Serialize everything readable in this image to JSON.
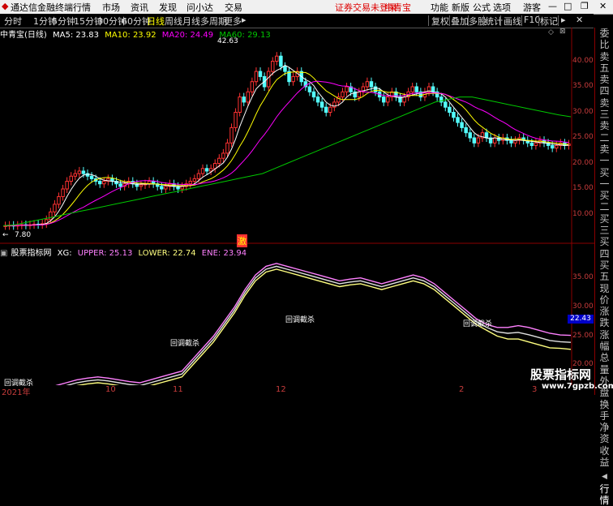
{
  "menubar": {
    "app_title": "通达信金融终端",
    "menus": [
      "行情",
      "市场",
      "资讯",
      "发现",
      "问小达",
      "交易"
    ],
    "alert": "证券交易未登录",
    "stock_name": "中青宝",
    "right": [
      "功能",
      "新版",
      "公式",
      "选项",
      "游客"
    ]
  },
  "toolbar": {
    "periods": [
      "分时",
      "1分钟",
      "5分钟",
      "15分钟",
      "30分钟",
      "60分钟",
      "日线",
      "周线",
      "月线",
      "多周期",
      "更多"
    ],
    "selected_period": "日线",
    "right_buttons": [
      "复权",
      "叠加",
      "多股",
      "统计",
      "画线",
      "F10",
      "标记"
    ]
  },
  "chart_header": {
    "title": "中青宝(日线)",
    "ma5": "MA5: 23.83",
    "ma10": "MA10: 23.92",
    "ma20": "MA20: 24.49",
    "ma60": "MA60: 29.13",
    "high_label": "42.63",
    "low_label": "7.80",
    "marker": "激"
  },
  "indicator_header": {
    "title": "股票指标网",
    "xg": "XG:",
    "upper": "UPPER: 25.13",
    "lower": "LOWER: 22.74",
    "ene": "ENE: 23.94"
  },
  "annotations": [
    "回调截杀",
    "回调截杀",
    "回调截杀",
    "回调截杀"
  ],
  "right_panel": [
    "委比",
    "卖五",
    "卖四",
    "卖三",
    "卖二",
    "卖一",
    "买一",
    "买二",
    "买三",
    "买四",
    "买五",
    "现价",
    "涨跌",
    "涨幅",
    "总量",
    "外盘",
    "换手",
    "净资",
    "收益",
    "行情"
  ],
  "right_panel_selected": "行情",
  "ind_current_value": "22.43",
  "x_axis": [
    "2021年",
    "10",
    "11",
    "12",
    "2",
    "3"
  ],
  "watermark": "股票指标网",
  "watermark_url": "www.7gpzb.com",
  "colors": {
    "up": "#ff3232",
    "down": "#54ffff",
    "ma5": "#ffffff",
    "ma10": "#ffff00",
    "ma20": "#ff00ff",
    "ma60": "#00c800",
    "upper": "#ff80ff",
    "lower": "#ffff80",
    "ene": "#e0e0e0"
  },
  "chart_data": [
    {
      "type": "candlestick",
      "title": "中青宝(日线)",
      "ylim": [
        5,
        45
      ],
      "yticks": [
        10.0,
        15.0,
        20.0,
        25.0,
        30.0,
        35.0,
        40.0
      ],
      "high_value": 42.63,
      "low_value": 7.8,
      "closes": [
        7.8,
        7.9,
        7.8,
        7.9,
        8.0,
        7.9,
        8.0,
        8.1,
        8.0,
        8.2,
        9.0,
        10.5,
        12.0,
        13.5,
        15.0,
        16.5,
        17.5,
        18.0,
        18.5,
        18.0,
        17.5,
        17.0,
        16.5,
        16.0,
        16.5,
        17.0,
        16.5,
        16.0,
        15.5,
        16.0,
        16.5,
        16.0,
        15.5,
        15.8,
        16.0,
        16.5,
        16.0,
        15.5,
        15.0,
        15.5,
        16.0,
        15.5,
        15.0,
        15.5,
        16.0,
        16.5,
        17.0,
        18.0,
        19.0,
        18.5,
        19.0,
        20.0,
        21.0,
        22.0,
        24.0,
        27.0,
        30.0,
        33.0,
        32.0,
        34.0,
        36.0,
        38.0,
        37.0,
        35.0,
        38.0,
        40.0,
        41.0,
        39.0,
        38.0,
        36.0,
        37.0,
        38.0,
        36.0,
        35.0,
        34.0,
        33.0,
        32.0,
        31.0,
        30.0,
        31.0,
        32.0,
        33.0,
        34.0,
        35.0,
        34.0,
        33.0,
        34.0,
        35.0,
        36.0,
        35.0,
        34.0,
        33.0,
        32.0,
        33.0,
        34.0,
        33.0,
        32.0,
        33.0,
        34.0,
        35.0,
        34.0,
        33.0,
        34.0,
        35.0,
        34.0,
        33.0,
        32.0,
        31.0,
        30.0,
        29.0,
        28.0,
        27.0,
        26.0,
        25.0,
        24.0,
        25.0,
        26.0,
        25.0,
        24.0,
        25.0,
        24.5,
        25.0,
        24.5,
        24.0,
        24.5,
        25.0,
        24.5,
        24.0,
        23.5,
        24.0,
        24.5,
        24.0,
        23.5,
        23.0,
        23.5,
        24.0,
        23.5,
        23.8
      ],
      "ma60": [
        7.8,
        8.0,
        8.5,
        9.0,
        9.5,
        10.0,
        10.5,
        11.0,
        11.5,
        12.0,
        12.5,
        13.0,
        13.5,
        14.0,
        14.5,
        15.0,
        15.5,
        16.0,
        16.5,
        17.0,
        17.5,
        18.0,
        19.0,
        20.0,
        21.0,
        22.0,
        23.0,
        24.0,
        25.0,
        26.0,
        27.0,
        28.0,
        29.0,
        30.0,
        31.0,
        32.0,
        32.5,
        33.0,
        33.0,
        32.5,
        32.0,
        31.5,
        31.0,
        30.5,
        30.0,
        29.5,
        29.13
      ],
      "series": [
        {
          "name": "MA5",
          "value": 23.83
        },
        {
          "name": "MA10",
          "value": 23.92
        },
        {
          "name": "MA20",
          "value": 24.49
        },
        {
          "name": "MA60",
          "value": 29.13
        }
      ]
    },
    {
      "type": "line",
      "title": "股票指标网",
      "ylim": [
        17,
        39
      ],
      "yticks": [
        20.0,
        25.0,
        30.0,
        35.0
      ],
      "upper": [
        13.5,
        14.0,
        14.5,
        15.0,
        15.8,
        16.5,
        17.0,
        17.5,
        17.8,
        18.0,
        17.8,
        17.5,
        17.2,
        17.0,
        17.5,
        18.0,
        18.5,
        19.0,
        21.0,
        23.0,
        25.0,
        27.5,
        30.0,
        33.0,
        35.5,
        37.0,
        37.5,
        37.0,
        36.5,
        36.0,
        35.5,
        35.0,
        34.5,
        34.8,
        35.0,
        34.5,
        34.0,
        34.5,
        35.0,
        35.5,
        35.0,
        34.0,
        32.5,
        31.0,
        29.5,
        28.0,
        27.0,
        26.5,
        26.5,
        26.8,
        26.5,
        26.0,
        25.5,
        25.2,
        25.13
      ],
      "lower": [
        12.5,
        13.0,
        13.5,
        14.0,
        14.8,
        15.5,
        16.0,
        16.5,
        16.8,
        17.0,
        16.8,
        16.5,
        16.2,
        16.0,
        16.5,
        17.0,
        17.5,
        18.0,
        20.0,
        22.0,
        24.0,
        26.5,
        29.0,
        32.0,
        34.5,
        36.0,
        36.5,
        36.0,
        35.5,
        35.0,
        34.5,
        34.0,
        33.5,
        33.8,
        34.0,
        33.5,
        33.0,
        33.5,
        34.0,
        34.5,
        34.0,
        33.0,
        31.5,
        30.0,
        28.5,
        27.0,
        26.0,
        25.0,
        24.5,
        24.5,
        24.0,
        23.5,
        23.0,
        22.9,
        22.74
      ],
      "series": [
        {
          "name": "UPPER",
          "value": 25.13
        },
        {
          "name": "LOWER",
          "value": 22.74
        },
        {
          "name": "ENE",
          "value": 23.94
        }
      ]
    }
  ]
}
